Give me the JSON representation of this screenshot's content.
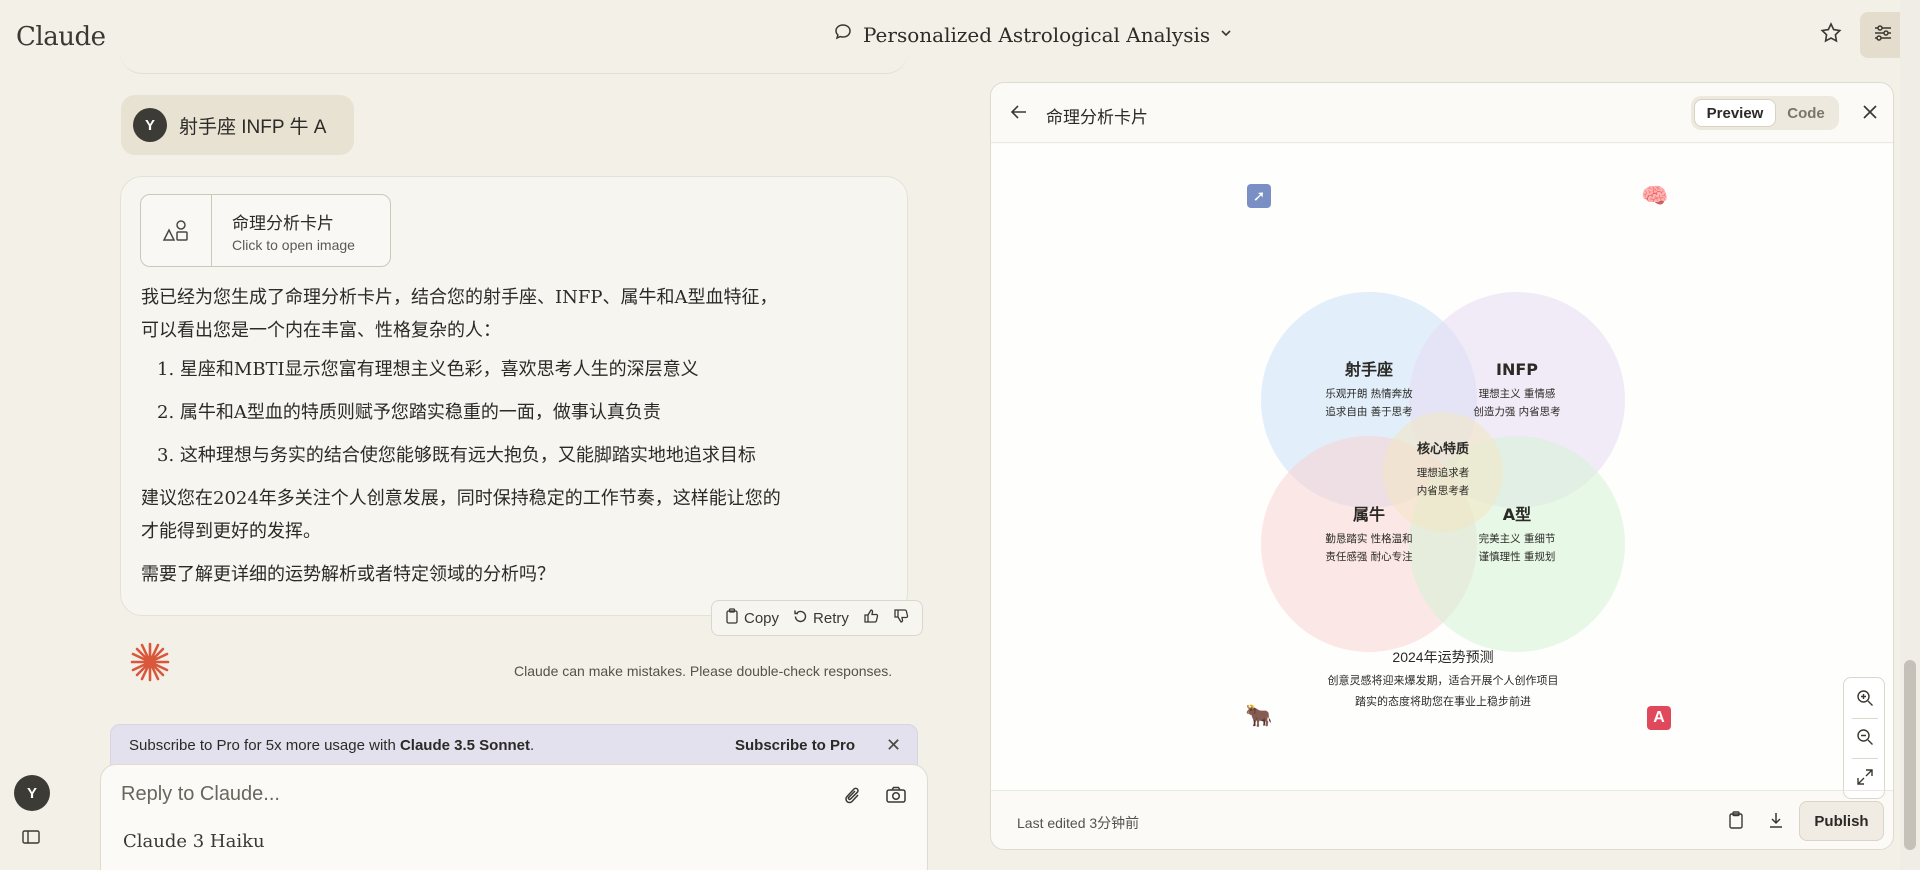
{
  "app": {
    "brand": "Claude"
  },
  "header": {
    "conversation_title": "Personalized Astrological Analysis"
  },
  "user_message": {
    "avatar": "Y",
    "text": "射手座 INFP 牛 A"
  },
  "artifact_chip": {
    "title": "命理分析卡片",
    "subtitle": "Click to open image"
  },
  "assistant_message": {
    "intro_line1": "我已经为您生成了命理分析卡片，结合您的射手座、INFP、属牛和A型血特征，",
    "intro_line2": "可以看出您是一个内在丰富、性格复杂的人：",
    "points": [
      "1. 星座和MBTI显示您富有理想主义色彩，喜欢思考人生的深层意义",
      "2. 属牛和A型血的特质则赋予您踏实稳重的一面，做事认真负责",
      "3. 这种理想与务实的结合使您能够既有远大抱负，又能脚踏实地地追求目标"
    ],
    "advice_line1": "建议您在2024年多关注个人创意发展，同时保持稳定的工作节奏，这样能让您的",
    "advice_line2": "才能得到更好的发挥。",
    "question": "需要了解更详细的运势解析或者特定领域的分析吗？"
  },
  "actions": {
    "copy": "Copy",
    "retry": "Retry"
  },
  "disclaimer": "Claude can make mistakes. Please double-check responses.",
  "promo": {
    "text_prefix": "Subscribe to Pro for 5x more usage with ",
    "text_bold": "Claude 3.5 Sonnet",
    "text_suffix": ".",
    "link": "Subscribe to Pro"
  },
  "composer": {
    "placeholder": "Reply to Claude...",
    "model": "Claude 3 Haiku"
  },
  "sidebar": {
    "avatar": "Y"
  },
  "panel": {
    "title": "命理分析卡片",
    "tab_preview": "Preview",
    "tab_code": "Code",
    "footer_edited": "Last edited 3分钟前",
    "publish": "Publish"
  },
  "card": {
    "corner_badge": "A",
    "circles": [
      {
        "title": "射手座",
        "line1": "乐观开朗 热情奔放",
        "line2": "追求自由 善于思考",
        "color": "#cfe2f7"
      },
      {
        "title": "INFP",
        "line1": "理想主义 重情感",
        "line2": "创造力强 内省思考",
        "color": "#e8def3"
      },
      {
        "title": "属牛",
        "line1": "勤恳踏实 性格温和",
        "line2": "责任感强 耐心专注",
        "color": "#f8d3d3"
      },
      {
        "title": "A型",
        "line1": "完美主义 重细节",
        "line2": "谨慎理性 重规划",
        "color": "#d5f2d6"
      }
    ],
    "core": {
      "title": "核心特质",
      "line1": "理想追求者",
      "line2": "内省思考者",
      "color": "#f3e6c2"
    },
    "forecast": {
      "title": "2024年运势预测",
      "line1": "创意灵感将迎来爆发期，适合开展个人创作项目",
      "line2": "踏实的态度将助您在事业上稳步前进"
    }
  },
  "colors": {
    "background": "#f3f0e8",
    "accent_spark": "#d9573b",
    "badge_red": "#e0485b",
    "badge_blue": "#7a90c4"
  }
}
